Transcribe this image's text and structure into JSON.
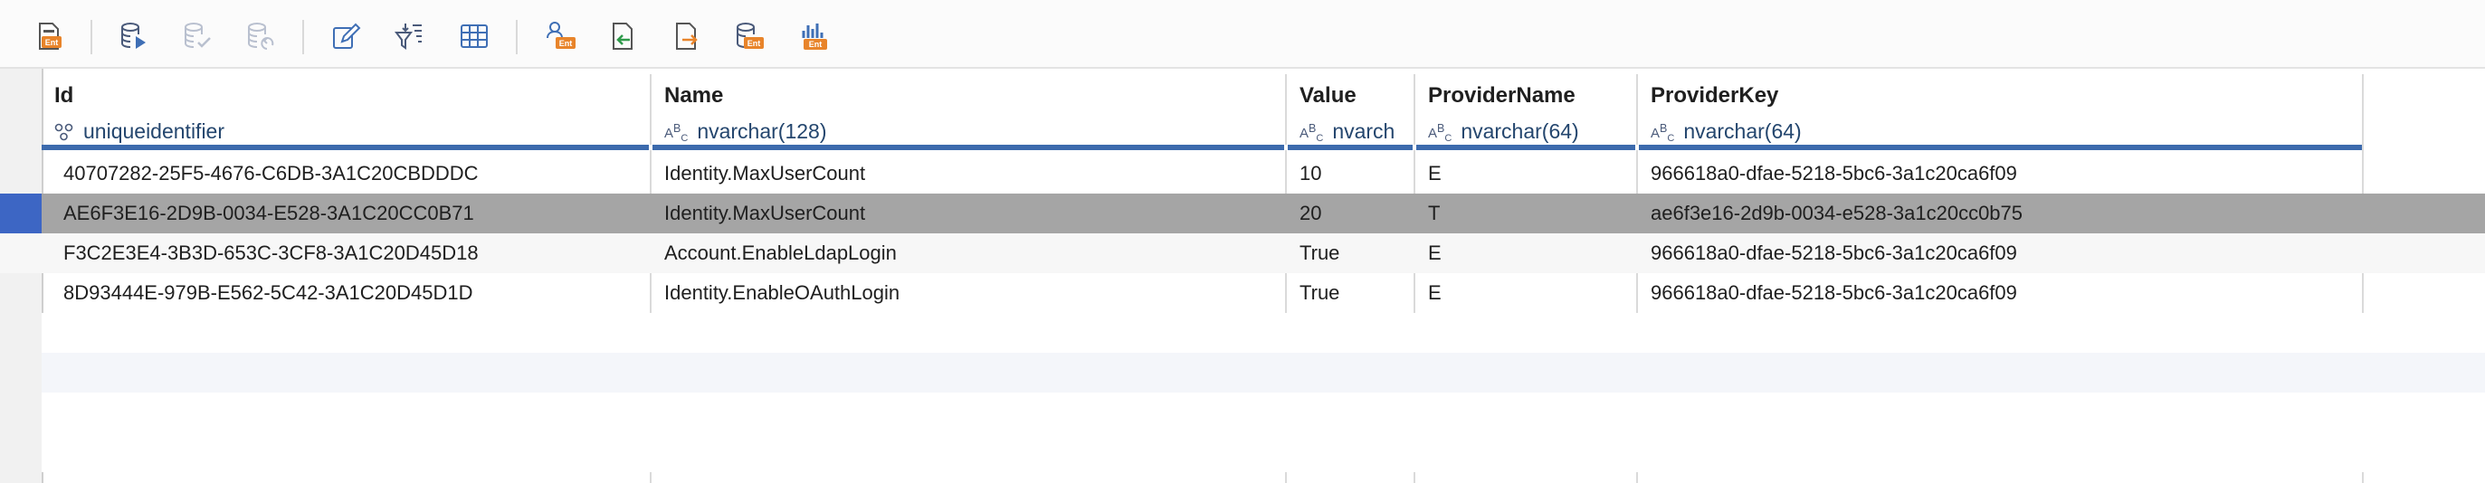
{
  "toolbar": {
    "buttons": [
      {
        "name": "export-ent-button",
        "icon": "export-ent-icon"
      },
      {
        "name": "execute-query-button",
        "icon": "database-run-icon"
      },
      {
        "name": "commit-button",
        "icon": "database-check-icon"
      },
      {
        "name": "rollback-button",
        "icon": "database-undo-icon"
      },
      {
        "name": "edit-button",
        "icon": "pencil-icon"
      },
      {
        "name": "filter-sort-button",
        "icon": "filter-sort-icon"
      },
      {
        "name": "grid-view-button",
        "icon": "grid-icon"
      },
      {
        "name": "generate-entity-button",
        "icon": "ent-search-icon"
      },
      {
        "name": "import-button",
        "icon": "import-arrow-icon"
      },
      {
        "name": "export-button",
        "icon": "export-arrow-icon"
      },
      {
        "name": "database-ent-button",
        "icon": "database-ent-icon"
      },
      {
        "name": "chart-ent-button",
        "icon": "chart-ent-icon"
      }
    ],
    "accent": "#e8842a",
    "blue": "#3f6fb5"
  },
  "columns": [
    {
      "name": "Id",
      "type": "uniqueidentifier",
      "type_icon": "key-icon"
    },
    {
      "name": "Name",
      "type": "nvarchar(128)",
      "type_icon": "abc-icon"
    },
    {
      "name": "Value",
      "type": "nvarch",
      "type_icon": "abc-icon"
    },
    {
      "name": "ProviderName",
      "type": "nvarchar(64)",
      "type_icon": "abc-icon"
    },
    {
      "name": "ProviderKey",
      "type": "nvarchar(64)",
      "type_icon": "abc-icon"
    }
  ],
  "rows": [
    {
      "Id": "40707282-25F5-4676-C6DB-3A1C20CBDDDC",
      "Name": "Identity.MaxUserCount",
      "Value": "10",
      "ProviderName": "E",
      "ProviderKey": "966618a0-dfae-5218-5bc6-3a1c20ca6f09",
      "selected": false
    },
    {
      "Id": "AE6F3E16-2D9B-0034-E528-3A1C20CC0B71",
      "Name": "Identity.MaxUserCount",
      "Value": "20",
      "ProviderName": "T",
      "ProviderKey": "ae6f3e16-2d9b-0034-e528-3a1c20cc0b75",
      "selected": true
    },
    {
      "Id": "F3C2E3E4-3B3D-653C-3CF8-3A1C20D45D18",
      "Name": "Account.EnableLdapLogin",
      "Value": "True",
      "ProviderName": "E",
      "ProviderKey": "966618a0-dfae-5218-5bc6-3a1c20ca6f09",
      "selected": false
    },
    {
      "Id": "8D93444E-979B-E562-5C42-3A1C20D45D1D",
      "Name": "Identity.EnableOAuthLogin",
      "Value": "True",
      "ProviderName": "E",
      "ProviderKey": "966618a0-dfae-5218-5bc6-3a1c20ca6f09",
      "selected": false
    }
  ],
  "colors": {
    "header_bar": "#3c6aad",
    "selected_row": "#a5a5a5",
    "selected_gutter": "#3d66c4",
    "type_text": "#24466e"
  }
}
